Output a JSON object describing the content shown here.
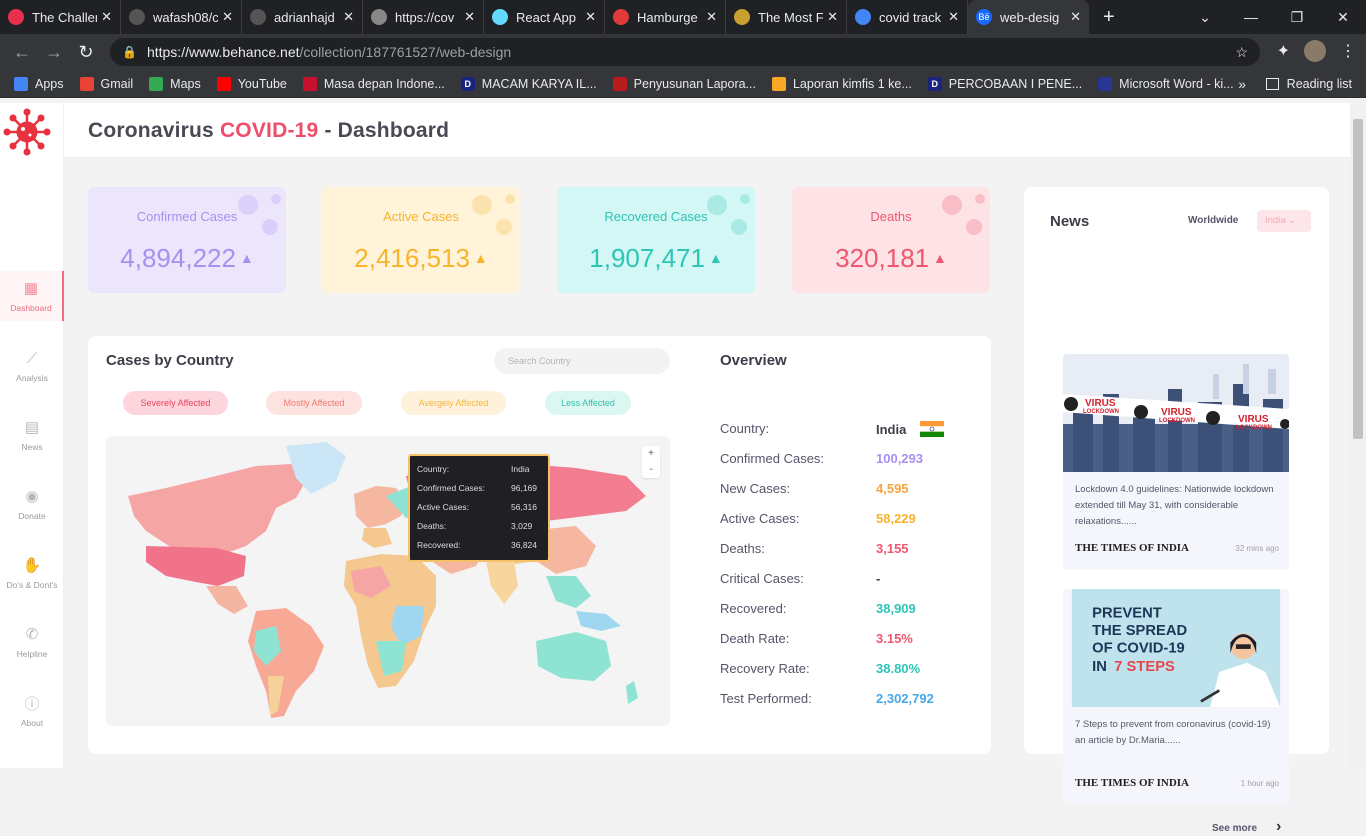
{
  "browser": {
    "tabs": [
      {
        "title": "The Challen",
        "icon_color": "#e8304e"
      },
      {
        "title": "wafash08/c",
        "icon_color": "#555"
      },
      {
        "title": "adrianhajd",
        "icon_color": "#555"
      },
      {
        "title": "https://cov",
        "icon_color": "#888"
      },
      {
        "title": "React App",
        "icon_color": "#61dafb"
      },
      {
        "title": "Hamburge",
        "icon_color": "#e03a3a"
      },
      {
        "title": "The Most F",
        "icon_color": "#c8a030"
      },
      {
        "title": "covid track",
        "icon_color": "#4285f4"
      },
      {
        "title": "web-desig",
        "icon_color": "#1769ff",
        "icon_text": "Bē"
      }
    ],
    "url_domain": "https://www.behance.net",
    "url_path": "/collection/187761527/web-design",
    "bookmarks": [
      {
        "label": "Apps",
        "color": "#4285f4"
      },
      {
        "label": "Gmail",
        "color": "#ea4335"
      },
      {
        "label": "Maps",
        "color": "#34a853"
      },
      {
        "label": "YouTube",
        "color": "#ff0000"
      },
      {
        "label": "Masa depan Indone...",
        "color": "#c8102e"
      },
      {
        "label": "MACAM KARYA IL...",
        "color": "#1a237e",
        "icon_text": "D"
      },
      {
        "label": "Penyusunan Lapora...",
        "color": "#b71c1c"
      },
      {
        "label": "Laporan kimfis 1 ke...",
        "color": "#f9a825"
      },
      {
        "label": "PERCOBAAN I PENE...",
        "color": "#1a237e",
        "icon_text": "D"
      },
      {
        "label": "Microsoft Word - ki...",
        "color": "#283593"
      }
    ],
    "more": "»",
    "reading_list": "Reading list"
  },
  "sidebar": {
    "items": [
      {
        "label": "Dashboard",
        "icon": "grid-icon"
      },
      {
        "label": "Analysis",
        "icon": "trend-icon"
      },
      {
        "label": "News",
        "icon": "news-icon"
      },
      {
        "label": "Donate",
        "icon": "donate-icon"
      },
      {
        "label": "Do's & Dont's",
        "icon": "hand-icon"
      },
      {
        "label": "Helpline",
        "icon": "phone-icon"
      },
      {
        "label": "About",
        "icon": "info-icon"
      }
    ]
  },
  "header": {
    "title_part1": "Coronavirus ",
    "title_highlight": "COVID-19",
    "title_part2": " - Dashboard"
  },
  "stats": [
    {
      "label": "Confirmed Cases",
      "value": "4,894,222",
      "color": "#a98ff0",
      "bg": "#ece6fd"
    },
    {
      "label": "Active Cases",
      "value": "2,416,513",
      "color": "#f7b42c",
      "bg": "#fff3d9"
    },
    {
      "label": "Recovered Cases",
      "value": "1,907,471",
      "color": "#2ec4b6",
      "bg": "#d3f7f4"
    },
    {
      "label": "Deaths",
      "value": "320,181",
      "color": "#f0566f",
      "bg": "#fde2e6"
    }
  ],
  "cases_by_country": {
    "title": "Cases by Country",
    "search_placeholder": "Search Country",
    "filters": [
      {
        "label": "Severely Affected",
        "bg": "#fdd5dc",
        "color": "#e8445f"
      },
      {
        "label": "Mostly Affected",
        "bg": "#fde3e0",
        "color": "#f07a70"
      },
      {
        "label": "Avergely Affected",
        "bg": "#fff2db",
        "color": "#f4b640"
      },
      {
        "label": "Less Affected",
        "bg": "#dcf6f2",
        "color": "#34c1ad"
      }
    ],
    "zoom_in": "+",
    "zoom_out": "-",
    "tooltip": {
      "rows": [
        {
          "label": "Country:",
          "value": "India"
        },
        {
          "label": "Confirmed Cases:",
          "value": "96,169"
        },
        {
          "label": "Active Cases:",
          "value": "56,316"
        },
        {
          "label": "Deaths:",
          "value": "3,029"
        },
        {
          "label": "Recovered:",
          "value": "36,824"
        }
      ]
    }
  },
  "overview": {
    "title": "Overview",
    "rows": [
      {
        "label": "Country:",
        "value": "India",
        "color": "#3d3d48"
      },
      {
        "label": "Confirmed Cases:",
        "value": "100,293",
        "color": "#a98ff0"
      },
      {
        "label": "New Cases:",
        "value": "4,595",
        "color": "#f7a53a"
      },
      {
        "label": "Active Cases:",
        "value": "58,229",
        "color": "#f7b42c"
      },
      {
        "label": "Deaths:",
        "value": "3,155",
        "color": "#f0566f"
      },
      {
        "label": "Critical Cases:",
        "value": "-",
        "color": "#3d3d48"
      },
      {
        "label": "Recovered:",
        "value": "38,909",
        "color": "#2ec4b6"
      },
      {
        "label": "Death Rate:",
        "value": "3.15%",
        "color": "#f0566f"
      },
      {
        "label": "Recovery Rate:",
        "value": "38.80%",
        "color": "#2ec4b6"
      },
      {
        "label": "Test Performed:",
        "value": "2,302,792",
        "color": "#45a8e8"
      }
    ]
  },
  "news": {
    "title": "News",
    "worldwide": "Worldwide",
    "region": "India",
    "items": [
      {
        "text": "Lockdown 4.0 guidelines: Nationwide lockdown extended till May 31, with considerable relaxations......",
        "source": "THE TIMES OF INDIA",
        "time": "32 mins ago",
        "banner": [
          "VIRUS",
          "LOCKDOWN"
        ]
      },
      {
        "text": "7 Steps to prevent from coronavirus (covid-19) an article by Dr.Maria......",
        "source": "THE TIMES OF INDIA",
        "time": "1 hour ago",
        "poster": [
          "PREVENT",
          "THE SPREAD",
          "OF COVID-19",
          "IN",
          "7 STEPS"
        ]
      }
    ],
    "see_more": "See more"
  }
}
